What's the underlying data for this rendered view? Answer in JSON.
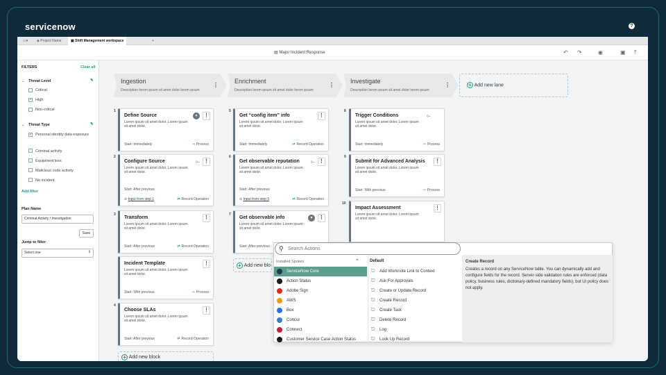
{
  "brand": "servicenow",
  "help_icon": "?",
  "tabs": {
    "project": "Project Name",
    "active": "Shift Management workspace",
    "add": "+"
  },
  "title": "Major Incident Response",
  "filters": {
    "heading": "FILTERS",
    "clear": "Clear all",
    "threat_level": {
      "label": "Threat Level",
      "options": [
        {
          "label": "Critical",
          "checked": false
        },
        {
          "label": "High",
          "checked": true
        },
        {
          "label": "Non-critical",
          "checked": false
        }
      ]
    },
    "threat_type": {
      "label": "Threat Type",
      "options": [
        {
          "label": "Personal identity data exposure",
          "checked": true
        },
        {
          "label": "Criminal activity",
          "checked": false
        },
        {
          "label": "Equipment loss",
          "checked": false
        },
        {
          "label": "Malicious code activity",
          "checked": false
        },
        {
          "label": "No incident",
          "checked": false
        }
      ]
    },
    "add_filter": "Add filter",
    "plan_name": {
      "label": "Plan Name",
      "value": "Criminal Activity / Investigation",
      "save": "Save"
    },
    "jump": {
      "label": "Jump to filter",
      "value": "Select one"
    }
  },
  "lanes": [
    {
      "name": "Ingestion",
      "desc": "Description lorem ipsum sit amet dolor lorem ipsum"
    },
    {
      "name": "Enrichment",
      "desc": "Description lorem ipsum sit amet dolor lorem ipsum"
    },
    {
      "name": "Investigate",
      "desc": "Description lorem ipsum sit amet dolor lorem ipsum"
    }
  ],
  "add_lane": "Add new lane",
  "add_block": "Add new block",
  "add_block_partial": "Add new blo",
  "cards": {
    "c1": {
      "num": "1",
      "title": "Define Source",
      "desc": "Lorem ipsum sit amet dolor. Lorem ipsum sit amet dolor.",
      "start": "Start: Immediately",
      "action": "Process"
    },
    "c2": {
      "num": "2",
      "title": "Configure Source",
      "desc": "Lorem ipsum sit amet dolor. Lorem ipsum sit amet dolor.",
      "start": "Start: After previous",
      "link": "Input from step 1",
      "action": "Record Operation"
    },
    "c3": {
      "num": "3",
      "title": "Transform",
      "desc": "Lorem ipsum sit amet dolor. Lorem ipsum sit amet dolor.",
      "start": "Start: After previous",
      "action": "Record Operation"
    },
    "c3b": {
      "title": "Incident Template",
      "desc": "Lorem ipsum sit amet dolor. Lorem ipsum sit amet dolor.",
      "start": "Start: With previous",
      "action": "Process"
    },
    "c4": {
      "num": "4",
      "title": "Choose SLAs",
      "desc": "Lorem ipsum sit amet dolor. Lorem ipsum sit amet dolor.",
      "start": "Start: After previous",
      "action": "Record Operation"
    },
    "c5": {
      "num": "5",
      "title": "Get “config item” info",
      "desc": "Lorem ipsum sit amet dolor. Lorem ipsum sit amet dolor.",
      "start": "Start: Immediately",
      "action": "Record Operation"
    },
    "c6": {
      "num": "6",
      "title": "Get observable reputation",
      "desc": "Lorem ipsum sit amet dolor. Lorem ipsum sit amet dolor.",
      "start": "Start: After previous",
      "link": "Input from step 5",
      "action": "Record Operation"
    },
    "c7": {
      "num": "7",
      "title": "Get observable info",
      "desc": "Lorem ipsum sit amet dolor. Lorem ipsum sit amet dolor.",
      "start": "Start: After previous"
    },
    "c8": {
      "num": "8",
      "title": "Trigger Conditions",
      "desc": "Lorem ipsum sit amet dolor. Lorem ipsum sit amet dolor.",
      "start": "Start: Immediately",
      "action": "Process"
    },
    "c9": {
      "num": "9",
      "title": "Submit for Advanced Analysis",
      "desc": "Lorem ipsum sit amet dolor. Lorem ipsum sit amet dolor.",
      "start": "Start: With previous",
      "action": "Process"
    },
    "c10": {
      "num": "10",
      "title": "Impact Assessment",
      "desc": "Lorem ipsum sit amet dolor. Lorem ipsum sit amet dolor."
    }
  },
  "actions_menu": {
    "placeholder": "Search Actions",
    "spokes_label": "Installed Spokes",
    "spokes": [
      {
        "name": "ServiceNow Core",
        "color": "#1d3b4d"
      },
      {
        "name": "Action Status",
        "color": "#1a1a1a"
      },
      {
        "name": "Adobe Sign",
        "color": "#e02a1c"
      },
      {
        "name": "AWS",
        "color": "#f29a13"
      },
      {
        "name": "Box",
        "color": "#2f6fd6"
      },
      {
        "name": "Concur",
        "color": "#3d7cc9"
      },
      {
        "name": "Connect",
        "color": "#c0242f"
      },
      {
        "name": "Customer Service Case Action Status",
        "color": "#1a1a1a"
      }
    ],
    "default_label": "Default",
    "actions": [
      "Add Worknote Link to Context",
      "Ask For Approvals",
      "Create or Update Record",
      "Create Record",
      "Create Task",
      "Delete Record",
      "Log",
      "Look Up Record"
    ],
    "desc_title": "Create Record",
    "desc_text": "Creates a record on any ServiceNow table. You can dynamically add and configure fields for the record. Server-side validation rules are enforced (data policy, business rules, dictionary-defined mandatory fields), but UI policy does not apply."
  }
}
